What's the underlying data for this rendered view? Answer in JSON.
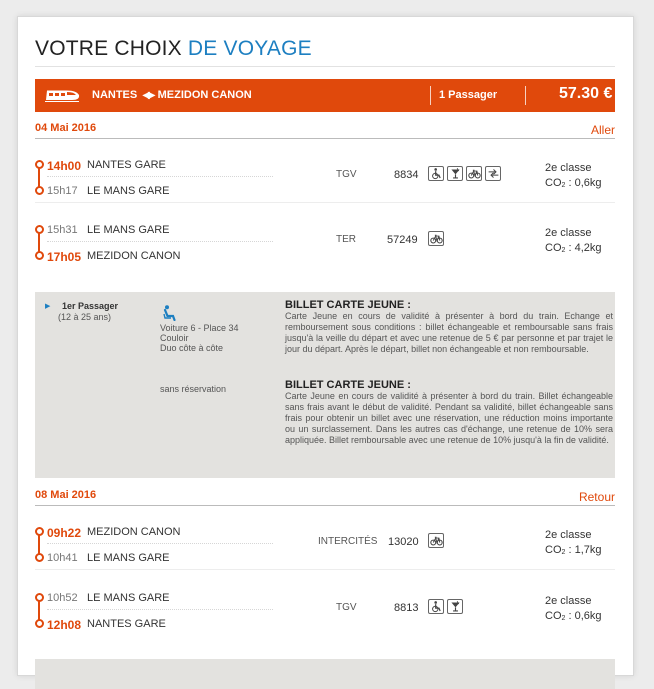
{
  "page": {
    "title_main": "VOTRE CHOIX ",
    "title_accent": "DE VOYAGE"
  },
  "banner": {
    "origin": "NANTES",
    "arrows": "◀▶",
    "destination": "MEZIDON CANON",
    "passengers": "1 Passager",
    "price": "57.30 €",
    "icon": "train-icon"
  },
  "outbound": {
    "date": "04 Mai 2016",
    "direction": "Aller",
    "segments": [
      {
        "dep_time": "14h00",
        "dep_station": "NANTES GARE",
        "arr_time": "15h17",
        "arr_station": "LE MANS GARE",
        "train_type": "TGV",
        "train_number": "8834",
        "class": "2e classe",
        "co2_label": "CO",
        "co2_sub": "2",
        "co2_value": " : 0,6kg",
        "services": [
          "wheelchair-icon",
          "bar-icon",
          "bike-icon",
          "arrows-icon"
        ]
      },
      {
        "dep_time": "15h31",
        "dep_station": "LE MANS GARE",
        "arr_time": "17h05",
        "arr_station": "MEZIDON CANON",
        "train_type": "TER",
        "train_number": "57249",
        "class": "2e classe",
        "co2_label": "CO",
        "co2_sub": "2",
        "co2_value": " : 4,2kg",
        "services": [
          "bike-icon"
        ]
      }
    ]
  },
  "passenger": {
    "name": "1er Passager",
    "age": "(12 à 25 ans)",
    "seat_icon": "seat-icon",
    "seat_line1": "Voiture 6 - Place 34",
    "seat_line2": "Couloir",
    "seat_line3": "Duo côte à côte",
    "no_reservation": "sans réservation",
    "fares": [
      {
        "title": "BILLET CARTE JEUNE :",
        "text": "Carte Jeune en cours de validité à présenter à bord du train. Echange et remboursement sous conditions : billet échangeable et remboursable sans frais jusqu'à la veille du départ et avec une retenue de 5 € par personne et par trajet le jour du départ. Après le départ, billet non échangeable et non remboursable."
      },
      {
        "title": "BILLET CARTE JEUNE :",
        "text": "Carte Jeune en cours de validité à présenter à bord du train. Billet échangeable sans frais avant le début de validité. Pendant sa validité, billet échangeable sans frais pour obtenir un billet avec une réservation, une réduction moins importante ou un surclassement. Dans les autres cas d'échange, une retenue de 10% sera appliquée. Billet remboursable avec une retenue de 10% jusqu'à la fin de validité."
      }
    ]
  },
  "return": {
    "date": "08 Mai 2016",
    "direction": "Retour",
    "segments": [
      {
        "dep_time": "09h22",
        "dep_station": "MEZIDON CANON",
        "arr_time": "10h41",
        "arr_station": "LE MANS GARE",
        "train_type": "INTERCITÉS",
        "train_number": "13020",
        "class": "2e classe",
        "co2_label": "CO",
        "co2_sub": "2",
        "co2_value": " : 1,7kg",
        "services": [
          "bike-icon"
        ]
      },
      {
        "dep_time": "10h52",
        "dep_station": "LE MANS GARE",
        "arr_time": "12h08",
        "arr_station": "NANTES GARE",
        "train_type": "TGV",
        "train_number": "8813",
        "class": "2e classe",
        "co2_label": "CO",
        "co2_sub": "2",
        "co2_value": " : 0,6kg",
        "services": [
          "wheelchair-icon",
          "bar-icon"
        ]
      }
    ]
  },
  "colors": {
    "accent": "#e0490c",
    "blue": "#1d7fc1",
    "box": "#e3e2df"
  }
}
